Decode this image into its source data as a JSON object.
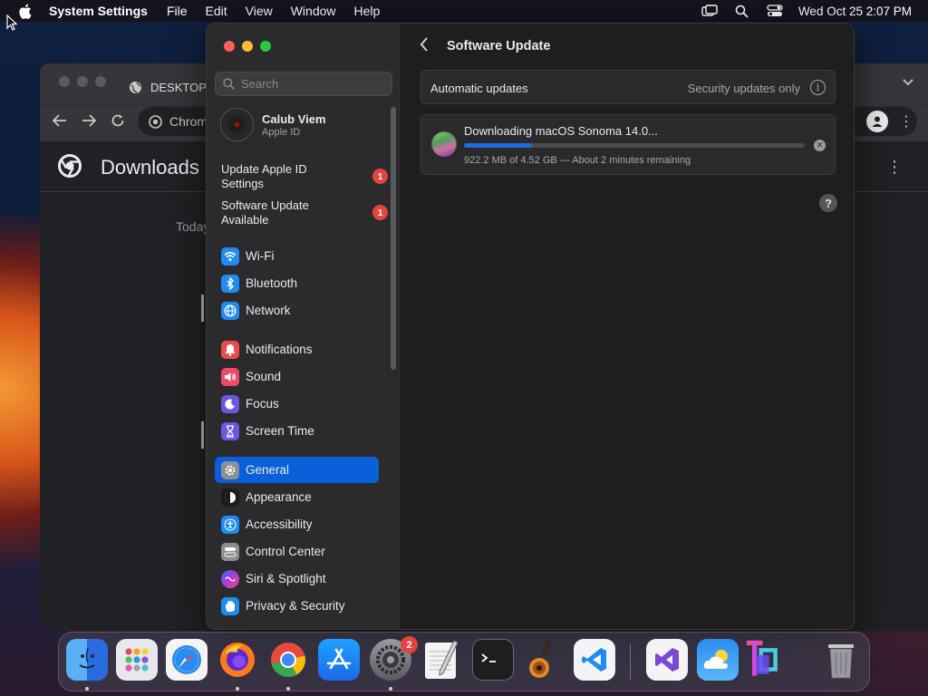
{
  "menubar": {
    "app_name": "System Settings",
    "menus": [
      "File",
      "Edit",
      "View",
      "Window",
      "Help"
    ],
    "clock": "Wed Oct 25  2:07 PM"
  },
  "chrome": {
    "tab_title": "DESKTOP",
    "omnibox_text": "Chrome",
    "page_title": "Downloads",
    "date_group": "Today"
  },
  "settings": {
    "search_placeholder": "Search",
    "account": {
      "name": "Calub Viem",
      "subtitle": "Apple ID"
    },
    "notices": [
      {
        "label": "Update Apple ID Settings",
        "badge": "1"
      },
      {
        "label": "Software Update Available",
        "badge": "1"
      }
    ],
    "sidebar": [
      {
        "label": "Wi-Fi",
        "icon": "wifi-icon",
        "color": "#1e8cf0"
      },
      {
        "label": "Bluetooth",
        "icon": "bluetooth-icon",
        "color": "#1e8cf0"
      },
      {
        "label": "Network",
        "icon": "globe-icon",
        "color": "#1e8cf0"
      },
      {
        "label": "Notifications",
        "icon": "bell-icon",
        "color": "#ec4a4a"
      },
      {
        "label": "Sound",
        "icon": "speaker-icon",
        "color": "#ec4a6a"
      },
      {
        "label": "Focus",
        "icon": "moon-icon",
        "color": "#6a58e0"
      },
      {
        "label": "Screen Time",
        "icon": "hourglass-icon",
        "color": "#6a58e0"
      },
      {
        "label": "General",
        "icon": "gear-icon",
        "color": "#8e8e93",
        "selected": true
      },
      {
        "label": "Appearance",
        "icon": "appearance-icon",
        "color": "#1c1c1e"
      },
      {
        "label": "Accessibility",
        "icon": "accessibility-icon",
        "color": "#1e8cf0"
      },
      {
        "label": "Control Center",
        "icon": "control-center-icon",
        "color": "#8e8e93"
      },
      {
        "label": "Siri & Spotlight",
        "icon": "siri-icon",
        "color": "#5a3ab8"
      },
      {
        "label": "Privacy & Security",
        "icon": "hand-icon",
        "color": "#1e8cf0"
      }
    ],
    "content": {
      "title": "Software Update",
      "automatic_updates_label": "Automatic updates",
      "automatic_updates_value": "Security updates only",
      "download": {
        "name": "Downloading macOS Sonoma 14.0...",
        "progress": 0.2,
        "detail": "922.2 MB of 4.52 GB — About 2 minutes remaining"
      },
      "help_label": "?"
    }
  },
  "dock": {
    "apps": [
      "Finder",
      "Launchpad",
      "Safari",
      "Firefox",
      "Google Chrome",
      "App Store",
      "System Settings",
      "TextEdit",
      "Terminal",
      "GarageBand",
      "Visual Studio Code",
      "Visual Studio",
      "Weather",
      "JetBrains",
      "Trash"
    ],
    "system_settings_badge": "2"
  }
}
